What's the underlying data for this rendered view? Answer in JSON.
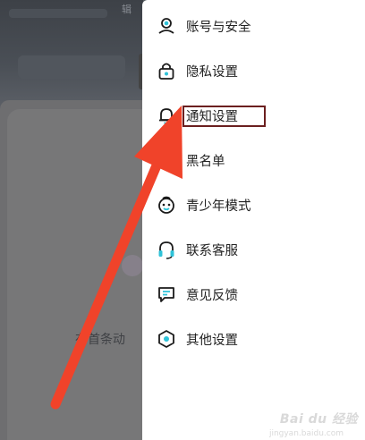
{
  "background": {
    "edit_label": "辑",
    "hint_text": "布首条动"
  },
  "menu": {
    "items": [
      {
        "label": "账号与安全",
        "icon": "account-security-icon"
      },
      {
        "label": "隐私设置",
        "icon": "lock-icon"
      },
      {
        "label": "通知设置",
        "icon": "bell-icon"
      },
      {
        "label": "黑名单",
        "icon": "blacklist-icon"
      },
      {
        "label": "青少年模式",
        "icon": "teen-mode-icon"
      },
      {
        "label": "联系客服",
        "icon": "headset-icon"
      },
      {
        "label": "意见反馈",
        "icon": "feedback-icon"
      },
      {
        "label": "其他设置",
        "icon": "other-settings-icon"
      }
    ]
  },
  "annotation": {
    "arrow_color": "#f0432a",
    "box_color": "#6b1f1f"
  },
  "watermark": {
    "text": "Bai du 经验",
    "sub": "jingyan.baidu.com"
  },
  "colors": {
    "icon_stroke": "#1a1a1a",
    "icon_accent": "#2fc3d9"
  }
}
